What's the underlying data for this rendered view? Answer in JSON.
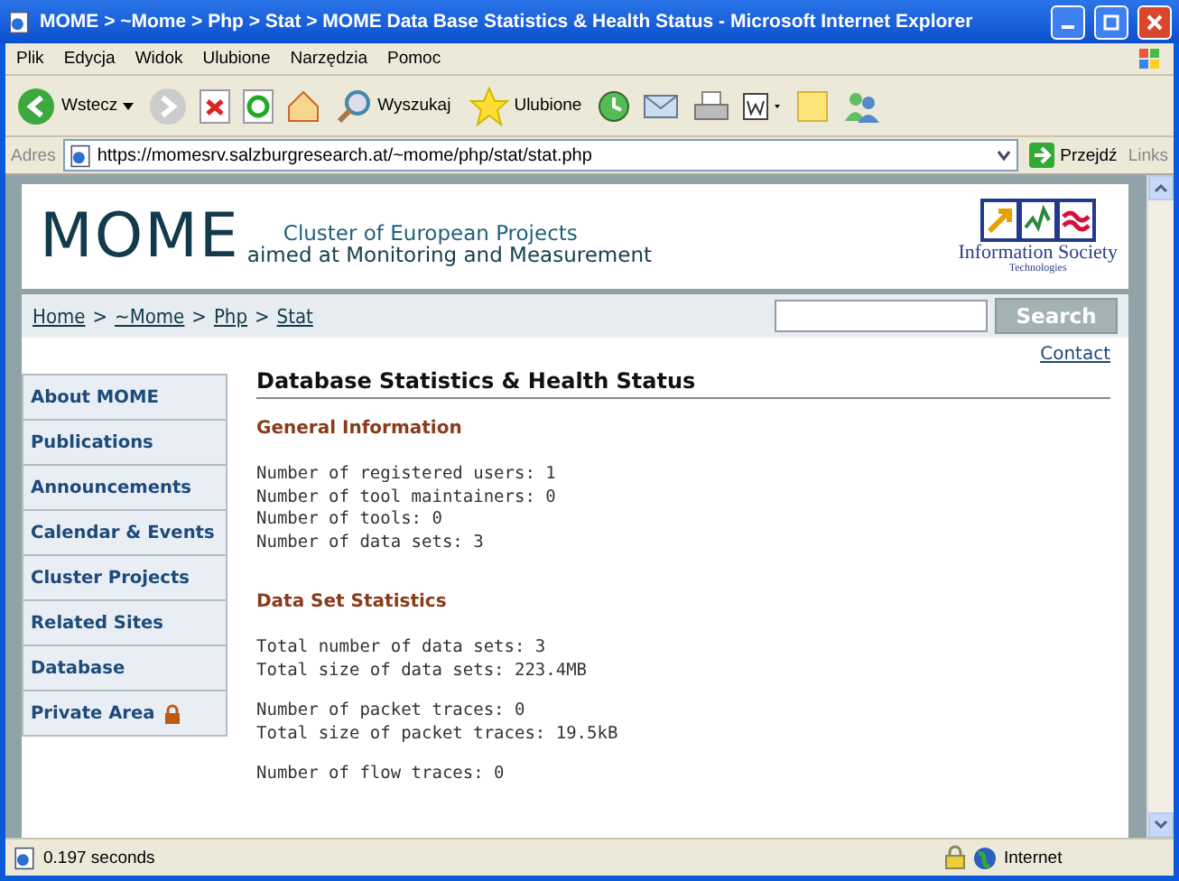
{
  "window": {
    "title": "MOME > ~Mome > Php > Stat > MOME Data Base Statistics & Health Status - Microsoft Internet Explorer"
  },
  "menu": [
    "Plik",
    "Edycja",
    "Widok",
    "Ulubione",
    "Narzędzia",
    "Pomoc"
  ],
  "toolbar": {
    "back": "Wstecz",
    "search": "Wyszukaj",
    "favorites": "Ulubione"
  },
  "address_bar": {
    "label": "Adres",
    "url": "https://momesrv.salzburgresearch.at/~mome/php/stat/stat.php",
    "go": "Przejdź",
    "links": "Links"
  },
  "page": {
    "logo": {
      "wordmark": "MOME",
      "line1": "Cluster of European Projects",
      "line2": "aimed at Monitoring and Measurement"
    },
    "ist_logo": {
      "line1": "Information Society",
      "line2": "Technologies"
    },
    "breadcrumb": [
      "Home",
      "~Mome",
      "Php",
      "Stat"
    ],
    "breadcrumb_separator": ">",
    "search": {
      "button": "Search"
    },
    "contact": "Contact",
    "nav": [
      {
        "label": "About MOME",
        "locked": false
      },
      {
        "label": "Publications",
        "locked": false
      },
      {
        "label": "Announcements",
        "locked": false
      },
      {
        "label": "Calendar & Events",
        "locked": false
      },
      {
        "label": "Cluster Projects",
        "locked": false
      },
      {
        "label": "Related Sites",
        "locked": false
      },
      {
        "label": "Database",
        "locked": false
      },
      {
        "label": "Private Area",
        "locked": true
      }
    ],
    "heading": "Database Statistics & Health Status",
    "sections": [
      {
        "title": "General Information",
        "groups": [
          [
            "Number of registered users: 1",
            "Number of tool maintainers: 0",
            "Number of tools: 0",
            "Number of data sets: 3"
          ]
        ]
      },
      {
        "title": "Data Set Statistics",
        "groups": [
          [
            "Total number of data sets: 3",
            "Total size of data sets: 223.4MB"
          ],
          [
            "Number of packet traces: 0",
            "Total size of packet traces: 19.5kB"
          ],
          [
            "Number of flow traces: 0"
          ]
        ]
      }
    ]
  },
  "status_bar": {
    "text": "0.197 seconds",
    "zone": "Internet"
  }
}
